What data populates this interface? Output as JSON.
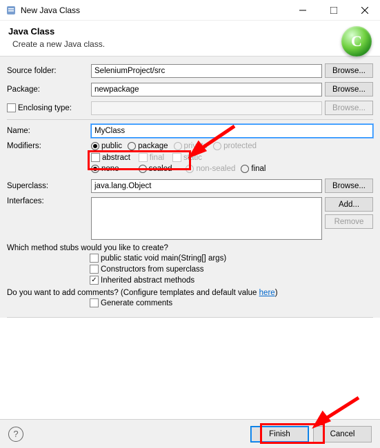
{
  "window": {
    "title": "New Java Class"
  },
  "header": {
    "title": "Java Class",
    "subtitle": "Create a new Java class.",
    "logo_letter": "C"
  },
  "form": {
    "source_folder_label": "Source folder:",
    "source_folder_value": "SeleniumProject/src",
    "package_label": "Package:",
    "package_value": "newpackage",
    "enclosing_label": "Enclosing type:",
    "enclosing_value": "",
    "name_label": "Name:",
    "name_value": "MyClass",
    "modifiers_label": "Modifiers:",
    "mod_public": "public",
    "mod_package": "package",
    "mod_private": "private",
    "mod_protected": "protected",
    "mod_abstract": "abstract",
    "mod_final": "final",
    "mod_static": "static",
    "mod_none": "none",
    "mod_sealed": "sealed",
    "mod_nonsealed": "non-sealed",
    "mod_final2": "final",
    "superclass_label": "Superclass:",
    "superclass_value": "java.lang.Object",
    "interfaces_label": "Interfaces:",
    "browse": "Browse...",
    "add": "Add...",
    "remove": "Remove"
  },
  "stubs": {
    "question": "Which method stubs would you like to create?",
    "main": "public static void main(String[] args)",
    "constructors": "Constructors from superclass",
    "inherited": "Inherited abstract methods"
  },
  "comments": {
    "question_prefix": "Do you want to add comments? (Configure templates and default value ",
    "here": "here",
    "question_suffix": ")",
    "generate": "Generate comments"
  },
  "buttons": {
    "finish": "Finish",
    "cancel": "Cancel"
  }
}
